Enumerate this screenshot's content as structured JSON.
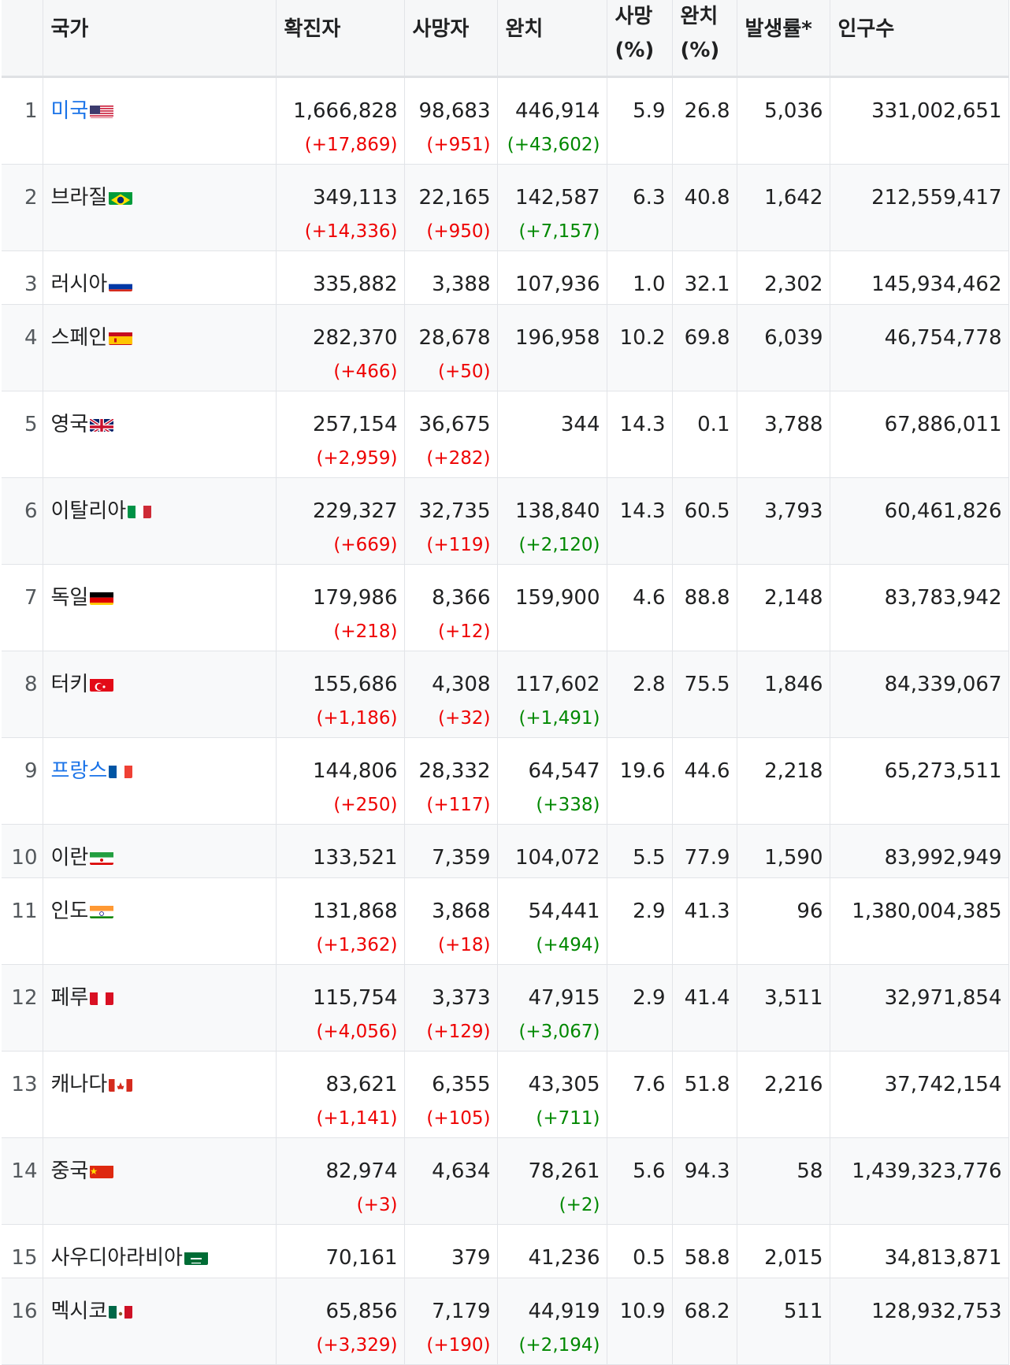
{
  "headers": {
    "country": "국가",
    "confirmed": "확진자",
    "deaths": "사망자",
    "recovered": "완치",
    "death_rate_1": "사망",
    "death_rate_2": "(%)",
    "recovery_rate_1": "완치",
    "recovery_rate_2": "(%)",
    "incidence": "발생률*",
    "population": "인구수"
  },
  "rows": [
    {
      "rank": "1",
      "country": "미국",
      "flag": "us",
      "link": true,
      "confirmed": "1,666,828",
      "confirmed_delta": "(+17,869)",
      "deaths": "98,683",
      "deaths_delta": "(+951)",
      "recovered": "446,914",
      "recovered_delta": "(+43,602)",
      "death_rate": "5.9",
      "recovery_rate": "26.8",
      "incidence": "5,036",
      "population": "331,002,651"
    },
    {
      "rank": "2",
      "country": "브라질",
      "flag": "br",
      "link": false,
      "confirmed": "349,113",
      "confirmed_delta": "(+14,336)",
      "deaths": "22,165",
      "deaths_delta": "(+950)",
      "recovered": "142,587",
      "recovered_delta": "(+7,157)",
      "death_rate": "6.3",
      "recovery_rate": "40.8",
      "incidence": "1,642",
      "population": "212,559,417"
    },
    {
      "rank": "3",
      "country": "러시아",
      "flag": "ru",
      "link": false,
      "confirmed": "335,882",
      "confirmed_delta": "",
      "deaths": "3,388",
      "deaths_delta": "",
      "recovered": "107,936",
      "recovered_delta": "",
      "death_rate": "1.0",
      "recovery_rate": "32.1",
      "incidence": "2,302",
      "population": "145,934,462"
    },
    {
      "rank": "4",
      "country": "스페인",
      "flag": "es",
      "link": false,
      "confirmed": "282,370",
      "confirmed_delta": "(+466)",
      "deaths": "28,678",
      "deaths_delta": "(+50)",
      "recovered": "196,958",
      "recovered_delta": "",
      "death_rate": "10.2",
      "recovery_rate": "69.8",
      "incidence": "6,039",
      "population": "46,754,778"
    },
    {
      "rank": "5",
      "country": "영국",
      "flag": "gb",
      "link": false,
      "confirmed": "257,154",
      "confirmed_delta": "(+2,959)",
      "deaths": "36,675",
      "deaths_delta": "(+282)",
      "recovered": "344",
      "recovered_delta": "",
      "death_rate": "14.3",
      "recovery_rate": "0.1",
      "incidence": "3,788",
      "population": "67,886,011"
    },
    {
      "rank": "6",
      "country": "이탈리아",
      "flag": "it",
      "link": false,
      "confirmed": "229,327",
      "confirmed_delta": "(+669)",
      "deaths": "32,735",
      "deaths_delta": "(+119)",
      "recovered": "138,840",
      "recovered_delta": "(+2,120)",
      "death_rate": "14.3",
      "recovery_rate": "60.5",
      "incidence": "3,793",
      "population": "60,461,826"
    },
    {
      "rank": "7",
      "country": "독일",
      "flag": "de",
      "link": false,
      "confirmed": "179,986",
      "confirmed_delta": "(+218)",
      "deaths": "8,366",
      "deaths_delta": "(+12)",
      "recovered": "159,900",
      "recovered_delta": "",
      "death_rate": "4.6",
      "recovery_rate": "88.8",
      "incidence": "2,148",
      "population": "83,783,942"
    },
    {
      "rank": "8",
      "country": "터키",
      "flag": "tr",
      "link": false,
      "confirmed": "155,686",
      "confirmed_delta": "(+1,186)",
      "deaths": "4,308",
      "deaths_delta": "(+32)",
      "recovered": "117,602",
      "recovered_delta": "(+1,491)",
      "death_rate": "2.8",
      "recovery_rate": "75.5",
      "incidence": "1,846",
      "population": "84,339,067"
    },
    {
      "rank": "9",
      "country": "프랑스",
      "flag": "fr",
      "link": true,
      "confirmed": "144,806",
      "confirmed_delta": "(+250)",
      "deaths": "28,332",
      "deaths_delta": "(+117)",
      "recovered": "64,547",
      "recovered_delta": "(+338)",
      "death_rate": "19.6",
      "recovery_rate": "44.6",
      "incidence": "2,218",
      "population": "65,273,511"
    },
    {
      "rank": "10",
      "country": "이란",
      "flag": "ir",
      "link": false,
      "confirmed": "133,521",
      "confirmed_delta": "",
      "deaths": "7,359",
      "deaths_delta": "",
      "recovered": "104,072",
      "recovered_delta": "",
      "death_rate": "5.5",
      "recovery_rate": "77.9",
      "incidence": "1,590",
      "population": "83,992,949"
    },
    {
      "rank": "11",
      "country": "인도",
      "flag": "in",
      "link": false,
      "confirmed": "131,868",
      "confirmed_delta": "(+1,362)",
      "deaths": "3,868",
      "deaths_delta": "(+18)",
      "recovered": "54,441",
      "recovered_delta": "(+494)",
      "death_rate": "2.9",
      "recovery_rate": "41.3",
      "incidence": "96",
      "population": "1,380,004,385"
    },
    {
      "rank": "12",
      "country": "페루",
      "flag": "pe",
      "link": false,
      "confirmed": "115,754",
      "confirmed_delta": "(+4,056)",
      "deaths": "3,373",
      "deaths_delta": "(+129)",
      "recovered": "47,915",
      "recovered_delta": "(+3,067)",
      "death_rate": "2.9",
      "recovery_rate": "41.4",
      "incidence": "3,511",
      "population": "32,971,854"
    },
    {
      "rank": "13",
      "country": "캐나다",
      "flag": "ca",
      "link": false,
      "confirmed": "83,621",
      "confirmed_delta": "(+1,141)",
      "deaths": "6,355",
      "deaths_delta": "(+105)",
      "recovered": "43,305",
      "recovered_delta": "(+711)",
      "death_rate": "7.6",
      "recovery_rate": "51.8",
      "incidence": "2,216",
      "population": "37,742,154"
    },
    {
      "rank": "14",
      "country": "중국",
      "flag": "cn",
      "link": false,
      "confirmed": "82,974",
      "confirmed_delta": "(+3)",
      "deaths": "4,634",
      "deaths_delta": "",
      "recovered": "78,261",
      "recovered_delta": "(+2)",
      "death_rate": "5.6",
      "recovery_rate": "94.3",
      "incidence": "58",
      "population": "1,439,323,776"
    },
    {
      "rank": "15",
      "country": "사우디아라비아",
      "flag": "sa",
      "link": false,
      "confirmed": "70,161",
      "confirmed_delta": "",
      "deaths": "379",
      "deaths_delta": "",
      "recovered": "41,236",
      "recovered_delta": "",
      "death_rate": "0.5",
      "recovery_rate": "58.8",
      "incidence": "2,015",
      "population": "34,813,871"
    },
    {
      "rank": "16",
      "country": "멕시코",
      "flag": "mx",
      "link": false,
      "confirmed": "65,856",
      "confirmed_delta": "(+3,329)",
      "deaths": "7,179",
      "deaths_delta": "(+190)",
      "recovered": "44,919",
      "recovered_delta": "(+2,194)",
      "death_rate": "10.9",
      "recovery_rate": "68.2",
      "incidence": "511",
      "population": "128,932,753"
    }
  ]
}
